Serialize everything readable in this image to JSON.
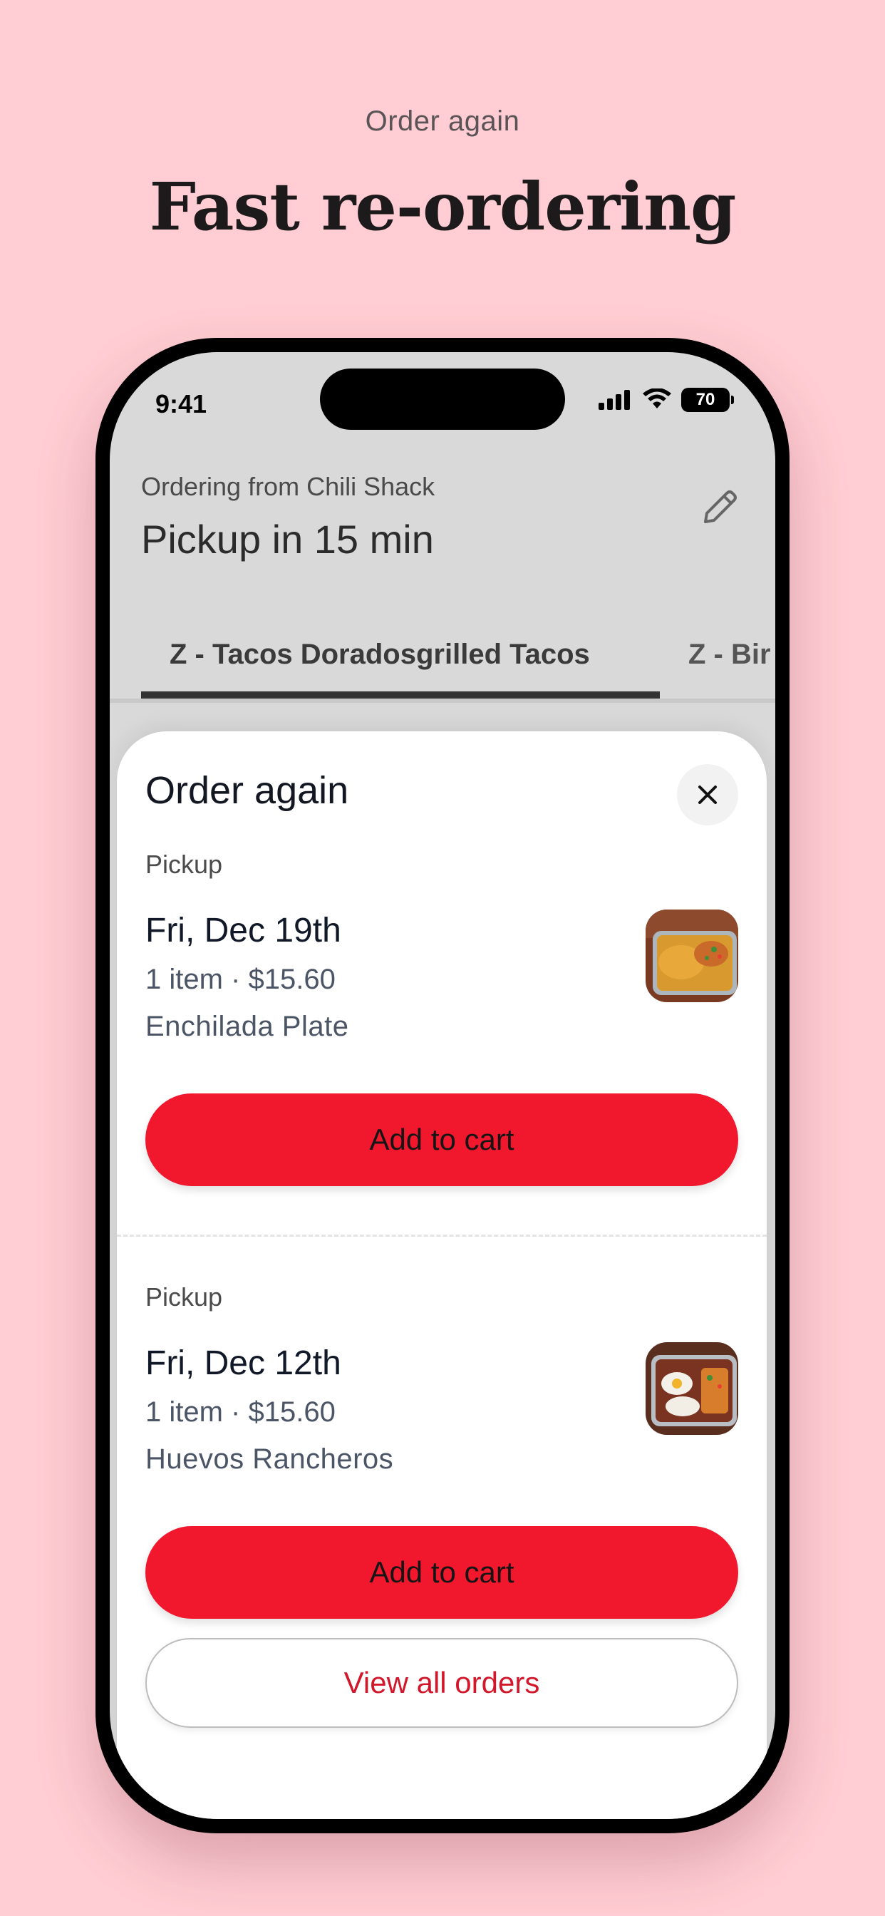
{
  "promo": {
    "subtitle": "Order again",
    "title": "Fast re-ordering"
  },
  "status_bar": {
    "time": "9:41",
    "battery": "70",
    "icons": [
      "signal-icon",
      "wifi-icon",
      "battery-icon"
    ]
  },
  "header": {
    "ordering_from": "Ordering from Chili Shack",
    "pickup_time": "Pickup in 15 min",
    "edit_icon": "pencil-icon"
  },
  "tabs": [
    {
      "label": "Z - Tacos Doradosgrilled Tacos",
      "active": true
    },
    {
      "label": "Z - Bir",
      "active": false
    }
  ],
  "sheet": {
    "title": "Order again",
    "close_icon": "close-icon",
    "orders": [
      {
        "type": "Pickup",
        "date": "Fri, Dec 19th",
        "meta": "1 item · $15.60",
        "item": "Enchilada Plate",
        "button": "Add to cart"
      },
      {
        "type": "Pickup",
        "date": "Fri, Dec 12th",
        "meta": "1 item · $15.60",
        "item": "Huevos Rancheros",
        "button": "Add to cart"
      }
    ],
    "view_all": "View all orders"
  },
  "colors": {
    "background": "#ffcdd3",
    "accent": "#f1172d",
    "link": "#d3172b"
  }
}
